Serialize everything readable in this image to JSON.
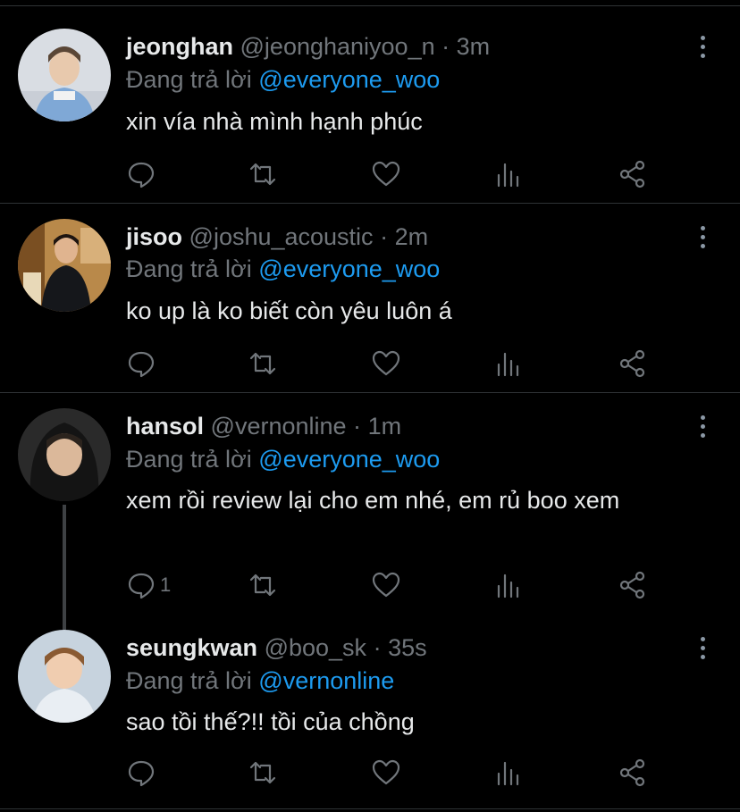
{
  "tweets": [
    {
      "name": "jeonghan",
      "handle": "@jeonghaniyoo_n",
      "time": "3m",
      "reply_prefix": "Đang trả lời",
      "reply_to": "@everyone_woo",
      "text": "xin vía nhà mình hạnh phúc",
      "reply_count": ""
    },
    {
      "name": "jisoo",
      "handle": "@joshu_acoustic",
      "time": "2m",
      "reply_prefix": "Đang trả lời",
      "reply_to": "@everyone_woo",
      "text": "ko up là ko biết còn yêu luôn á",
      "reply_count": ""
    },
    {
      "name": "hansol",
      "handle": "@vernonline",
      "time": "1m",
      "reply_prefix": "Đang trả lời",
      "reply_to": "@everyone_woo",
      "text": "xem rồi review lại cho em nhé, em rủ boo xem",
      "reply_count": "1"
    },
    {
      "name": "seungkwan",
      "handle": "@boo_sk",
      "time": "35s",
      "reply_prefix": "Đang trả lời",
      "reply_to": "@vernonline",
      "text": "sao tồi thế?!! tồi của chồng",
      "reply_count": ""
    }
  ],
  "separator": "·",
  "icons": [
    "reply-icon",
    "retweet-icon",
    "like-icon",
    "analytics-icon",
    "share-icon",
    "more-icon"
  ],
  "colors": {
    "background": "#000000",
    "accent": "#1d9bf0",
    "muted": "#71767b",
    "text": "#e7e9ea"
  }
}
